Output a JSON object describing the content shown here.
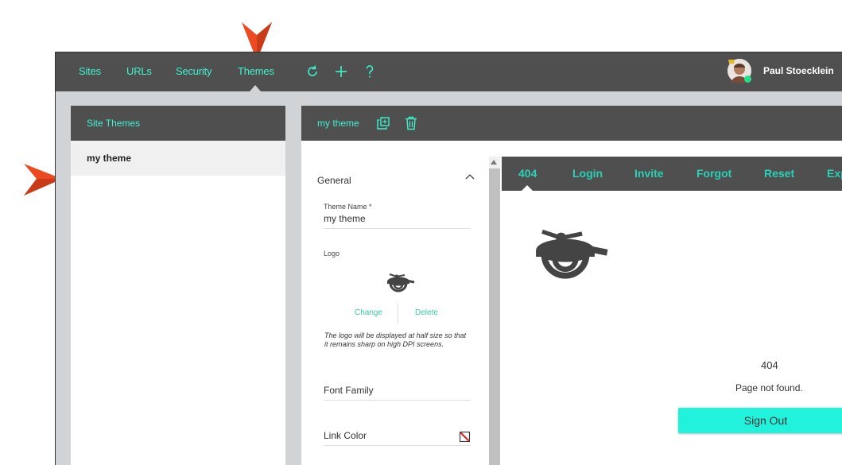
{
  "topbar": {
    "nav": [
      "Sites",
      "URLs",
      "Security",
      "Themes"
    ],
    "active": "Themes",
    "icons": [
      "refresh-icon",
      "plus-icon",
      "help-icon"
    ],
    "user_name": "Paul Stoecklein"
  },
  "left_panel": {
    "title": "Site Themes",
    "items": [
      "my theme"
    ]
  },
  "main_panel": {
    "title": "my theme",
    "icons": [
      "duplicate-icon",
      "trash-icon"
    ]
  },
  "settings": {
    "section_title": "General",
    "theme_name_label": "Theme Name *",
    "theme_name_value": "my theme",
    "logo_label": "Logo",
    "change_label": "Change",
    "delete_label": "Delete",
    "logo_help": "The logo will be displayed at half size so that it remains sharp on high DPI screens.",
    "font_family_label": "Font Family",
    "link_color_label": "Link Color"
  },
  "preview": {
    "tabs": [
      "404",
      "Login",
      "Invite",
      "Forgot",
      "Reset",
      "Exp"
    ],
    "active_tab": "404",
    "code": "404",
    "message": "Page not found.",
    "button": "Sign Out"
  },
  "colors": {
    "accent": "#3df2cf",
    "bar": "#4f4f4f",
    "button": "#21f2dc",
    "annotation": "#ee4a22"
  }
}
